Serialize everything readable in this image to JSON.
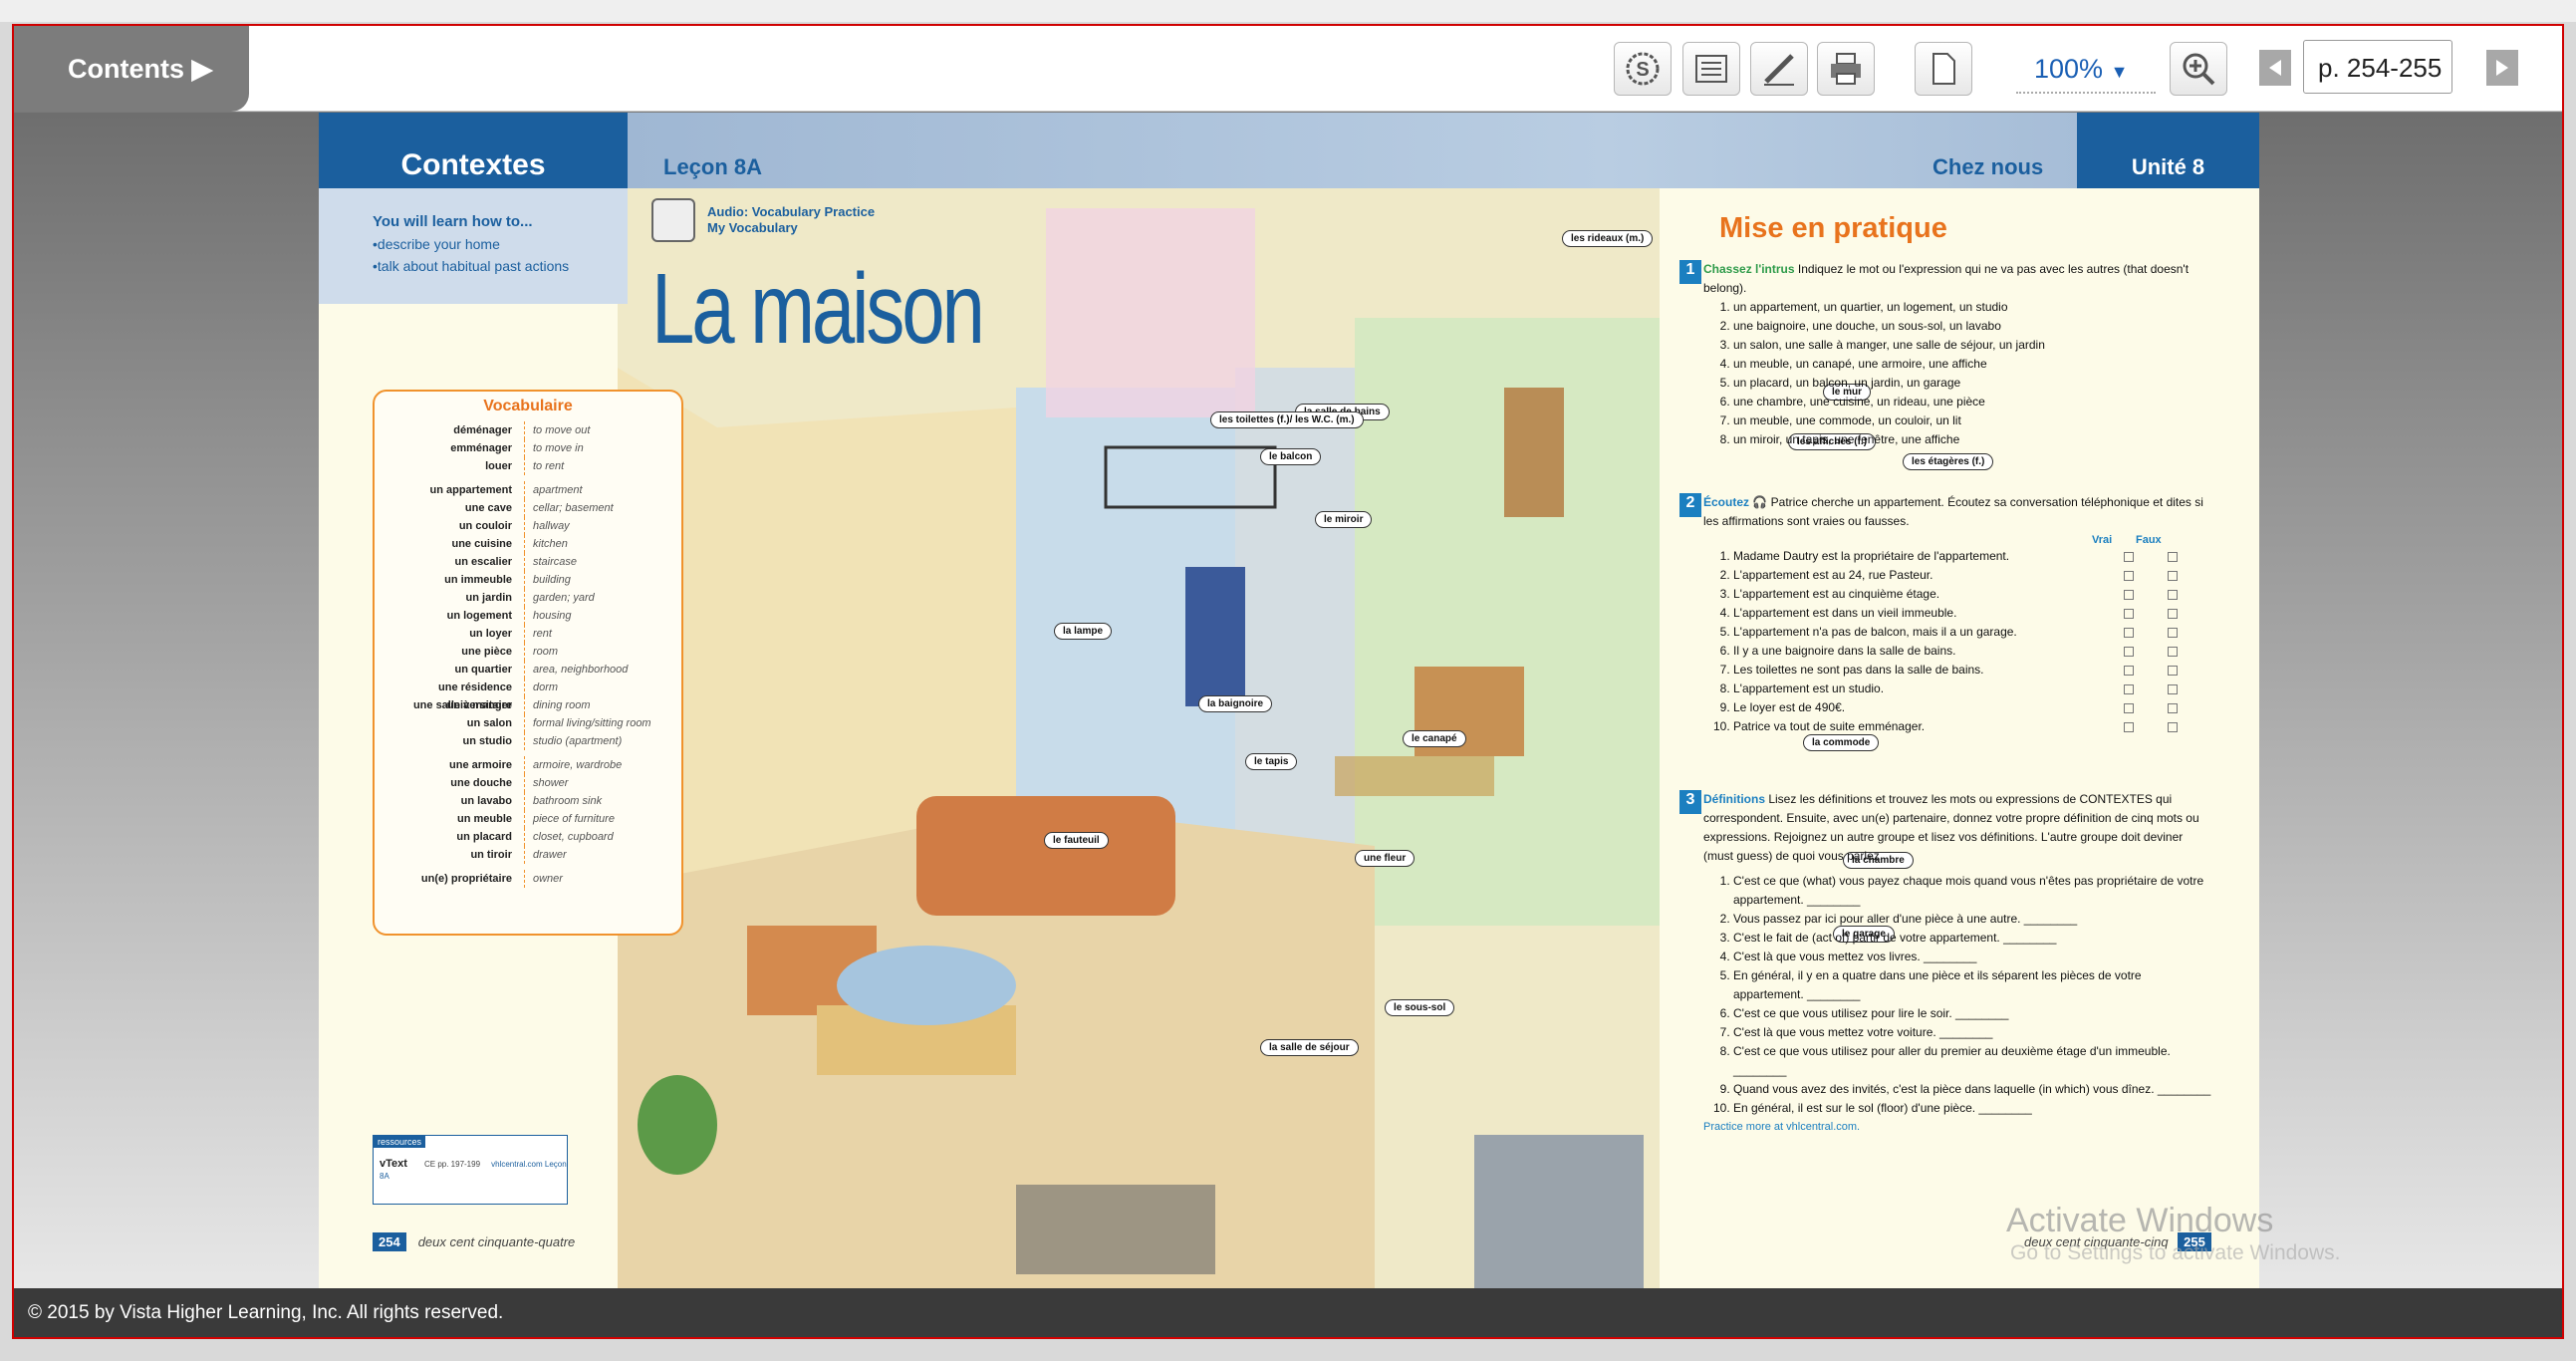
{
  "toolbar": {
    "contents_label": "Contents ▶",
    "zoom": "100%",
    "page": "p. 254-255"
  },
  "book": {
    "left_header": "Contextes",
    "lesson": "Leçon 8A",
    "chez": "Chez nous",
    "unite": "Unité 8",
    "learn_title": "You will learn how to...",
    "learn_items": [
      "•describe your home",
      "•talk about habitual past actions"
    ],
    "audio_line1": "Audio: Vocabulary Practice",
    "audio_line2": "My Vocabulary",
    "title": "La maison",
    "vocab_title": "Vocabulaire",
    "vocab": [
      [
        "déménager",
        "to move out"
      ],
      [
        "emménager",
        "to move in"
      ],
      [
        "louer",
        "to rent"
      ],
      [
        "",
        ""
      ],
      [
        "un appartement",
        "apartment"
      ],
      [
        "une cave",
        "cellar; basement"
      ],
      [
        "un couloir",
        "hallway"
      ],
      [
        "une cuisine",
        "kitchen"
      ],
      [
        "un escalier",
        "staircase"
      ],
      [
        "un immeuble",
        "building"
      ],
      [
        "un jardin",
        "garden; yard"
      ],
      [
        "un logement",
        "housing"
      ],
      [
        "un loyer",
        "rent"
      ],
      [
        "une pièce",
        "room"
      ],
      [
        "un quartier",
        "area, neighborhood"
      ],
      [
        "une résidence universitaire",
        "dorm"
      ],
      [
        "une salle à manger",
        "dining room"
      ],
      [
        "un salon",
        "formal living/sitting room"
      ],
      [
        "un studio",
        "studio (apartment)"
      ],
      [
        "",
        ""
      ],
      [
        "une armoire",
        "armoire, wardrobe"
      ],
      [
        "une douche",
        "shower"
      ],
      [
        "un lavabo",
        "bathroom sink"
      ],
      [
        "un meuble",
        "piece of furniture"
      ],
      [
        "un placard",
        "closet, cupboard"
      ],
      [
        "un tiroir",
        "drawer"
      ],
      [
        "",
        ""
      ],
      [
        "un(e) propriétaire",
        "owner"
      ]
    ],
    "res_label": "ressources",
    "res_vtext": "vText",
    "res_cp": "CE pp. 197-199",
    "res_site": "vhlcentral.com Leçon 8A",
    "left_page": "254",
    "left_page_words": "deux cent cinquante-quatre",
    "right_page": "255",
    "right_page_words": "deux cent cinquante-cinq",
    "labels": [
      "les rideaux (m.)",
      "le balcon",
      "la salle de bains",
      "les toilettes (f.)/ les W.C. (m.)",
      "le miroir",
      "la lampe",
      "la baignoire",
      "le tapis",
      "le canapé",
      "le fauteuil",
      "une fleur",
      "le sous-sol",
      "la salle de séjour",
      "le mur",
      "les affiches (f.)",
      "les étagères (f.)",
      "la commode",
      "la chambre",
      "le garage"
    ],
    "mise": "Mise en pratique",
    "s1_title": "Chassez l'intrus",
    "s1_instr": "Indiquez le mot ou l'expression qui ne va pas avec les autres (that doesn't belong).",
    "s1_items": [
      "un appartement, un quartier, un logement, un studio",
      "une baignoire, une douche, un sous-sol, un lavabo",
      "un salon, une salle à manger, une salle de séjour, un jardin",
      "un meuble, un canapé, une armoire, une affiche",
      "un placard, un balcon, un jardin, un garage",
      "une chambre, une cuisine, un rideau, une pièce",
      "un meuble, une commode, un couloir, un lit",
      "un miroir, un tapis, une fenêtre, une affiche"
    ],
    "s2_title": "Écoutez",
    "s2_instr": "Patrice cherche un appartement. Écoutez sa conversation téléphonique et dites si les affirmations sont vraies ou fausses.",
    "s2_vrai": "Vrai",
    "s2_faux": "Faux",
    "s2_items": [
      "Madame Dautry est la propriétaire de l'appartement.",
      "L'appartement est au 24, rue Pasteur.",
      "L'appartement est au cinquième étage.",
      "L'appartement est dans un vieil immeuble.",
      "L'appartement n'a pas de balcon, mais il a un garage.",
      "Il y a une baignoire dans la salle de bains.",
      "Les toilettes ne sont pas dans la salle de bains.",
      "L'appartement est un studio.",
      "Le loyer est de 490€.",
      "Patrice va tout de suite emménager."
    ],
    "s3_title": "Définitions",
    "s3_instr": "Lisez les définitions et trouvez les mots ou expressions de CONTEXTES qui correspondent. Ensuite, avec un(e) partenaire, donnez votre propre définition de cinq mots ou expressions. Rejoignez un autre groupe et lisez vos définitions. L'autre groupe doit deviner (must guess) de quoi vous parlez.",
    "s3_items": [
      "C'est ce que (what) vous payez chaque mois quand vous n'êtes pas propriétaire de votre appartement. ________",
      "Vous passez par ici pour aller d'une pièce à une autre. ________",
      "C'est le fait de (act of) partir de votre appartement. ________",
      "C'est là que vous mettez vos livres. ________",
      "En général, il y en a quatre dans une pièce et ils séparent les pièces de votre appartement. ________",
      "C'est ce que vous utilisez pour lire le soir. ________",
      "C'est là que vous mettez votre voiture. ________",
      "C'est ce que vous utilisez pour aller du premier au deuxième étage d'un immeuble. ________",
      "Quand vous avez des invités, c'est la pièce dans laquelle (in which) vous dînez. ________",
      "En général, il est sur le sol (floor) d'une pièce. ________"
    ],
    "practice": "Practice more at vhlcentral.com."
  },
  "footer": "© 2015 by Vista Higher Learning, Inc. All rights reserved.",
  "watermark": "Activate Windows",
  "watermark2": "Go to Settings to activate Windows."
}
